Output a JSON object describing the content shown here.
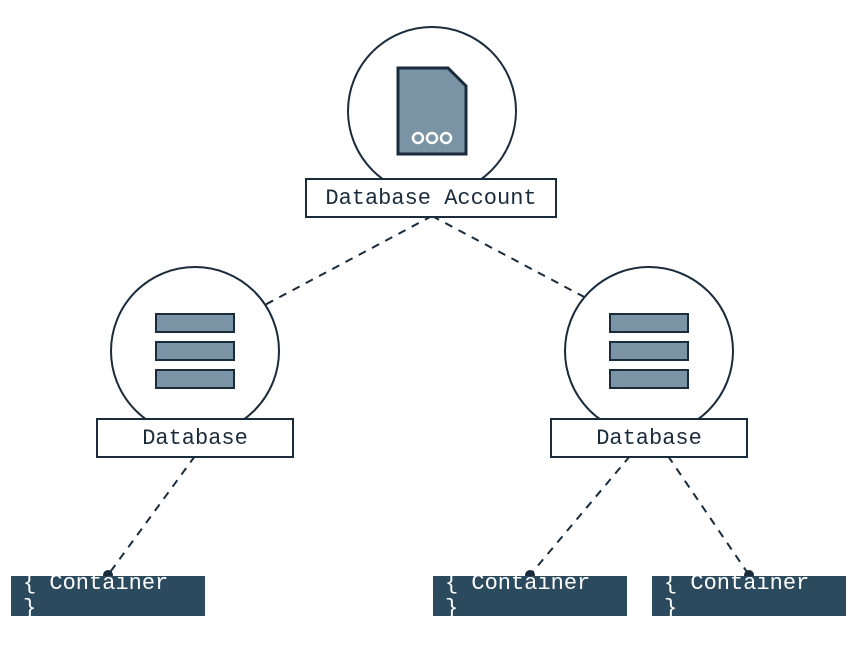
{
  "colors": {
    "stroke": "#1a2b3c",
    "fill_muted": "#7a94a6",
    "container_bg": "#2c4a5e",
    "white": "#ffffff"
  },
  "account": {
    "label": "Database Account"
  },
  "databases": [
    {
      "label": "Database"
    },
    {
      "label": "Database"
    }
  ],
  "containers": [
    {
      "label": "{ Container }"
    },
    {
      "label": "{ Container }"
    },
    {
      "label": "{ Container }"
    }
  ]
}
